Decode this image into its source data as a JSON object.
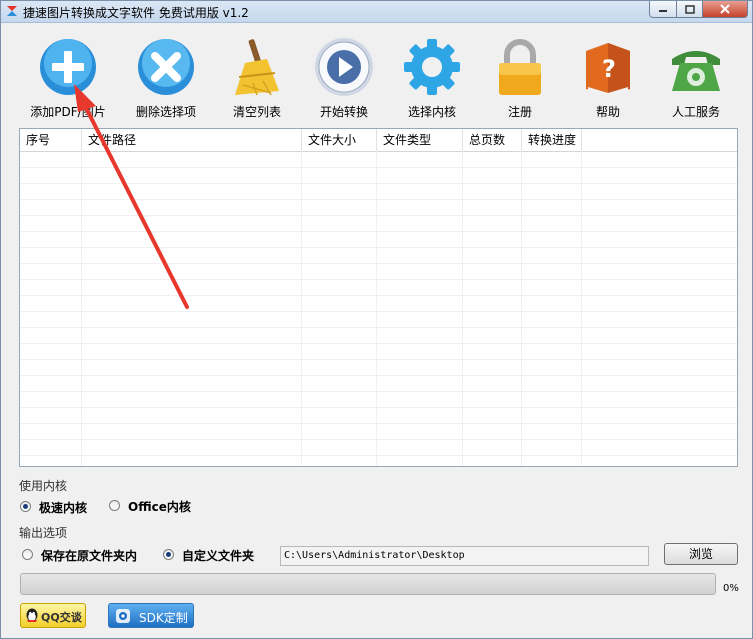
{
  "window": {
    "title": "捷速图片转换成文字软件 免费试用版 v1.2"
  },
  "toolbar": {
    "items": [
      {
        "label": "添加PDF/图片",
        "icon": "add-icon"
      },
      {
        "label": "删除选择项",
        "icon": "delete-icon"
      },
      {
        "label": "清空列表",
        "icon": "broom-icon"
      },
      {
        "label": "开始转换",
        "icon": "play-icon"
      },
      {
        "label": "选择内核",
        "icon": "gear-icon"
      },
      {
        "label": "注册",
        "icon": "lock-icon"
      },
      {
        "label": "帮助",
        "icon": "help-book-icon"
      },
      {
        "label": "人工服务",
        "icon": "phone-icon"
      }
    ]
  },
  "table": {
    "columns": [
      "序号",
      "文件路径",
      "文件大小",
      "文件类型",
      "总页数",
      "转换进度"
    ],
    "rows": []
  },
  "engine": {
    "label": "使用内核",
    "options": [
      {
        "label": "极速内核",
        "selected": true
      },
      {
        "label": "Office内核",
        "selected": false
      }
    ]
  },
  "output": {
    "label": "输出选项",
    "options": [
      {
        "label": "保存在原文件夹内",
        "selected": false
      },
      {
        "label": "自定义文件夹",
        "selected": true
      }
    ],
    "path": "C:\\Users\\Administrator\\Desktop",
    "browse_label": "浏览"
  },
  "progress": {
    "value": 0,
    "text": "0%"
  },
  "footer": {
    "qq_label": "QQ交谈",
    "sdk_label": "SDK定制"
  },
  "colors": {
    "accent_blue": "#2a8fd8",
    "annotation_arrow": "#e8382e"
  }
}
